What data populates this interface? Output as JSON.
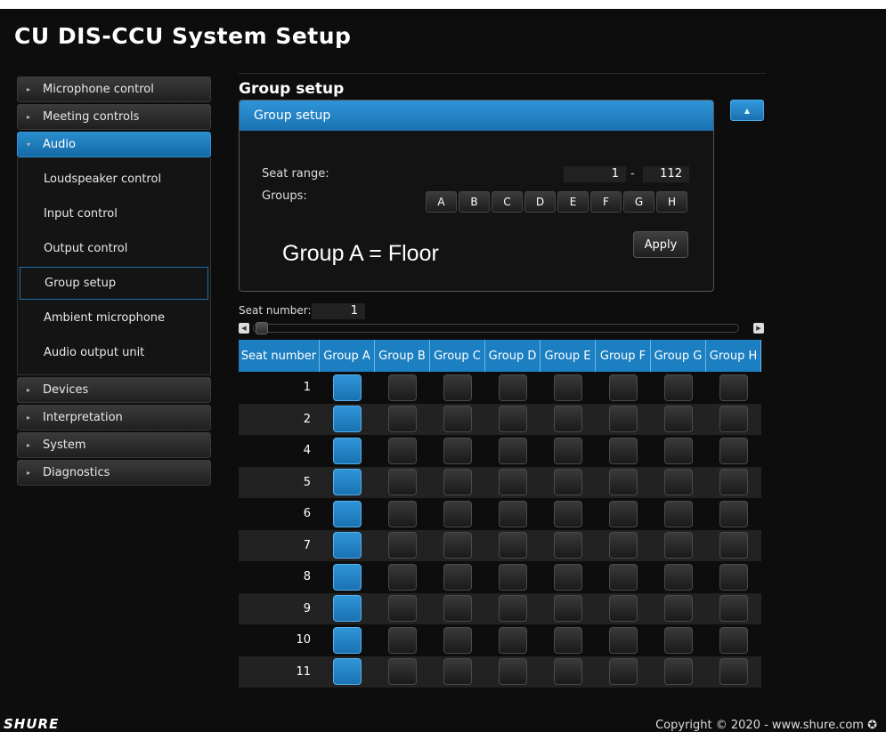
{
  "app": {
    "title": "CU DIS-CCU System Setup"
  },
  "sidebar": {
    "items": [
      {
        "label": "Microphone control"
      },
      {
        "label": "Meeting controls"
      },
      {
        "label": "Audio"
      },
      {
        "label": "Devices"
      },
      {
        "label": "Interpretation"
      },
      {
        "label": "System"
      },
      {
        "label": "Diagnostics"
      }
    ],
    "audio_subitems": [
      {
        "label": "Loudspeaker control"
      },
      {
        "label": "Input control"
      },
      {
        "label": "Output control"
      },
      {
        "label": "Group setup"
      },
      {
        "label": "Ambient microphone"
      },
      {
        "label": "Audio output unit"
      }
    ],
    "selected": "Group setup"
  },
  "main": {
    "section_title": "Group setup",
    "panel": {
      "title": "Group setup",
      "seat_range_label": "Seat range:",
      "seat_range_from": "1",
      "seat_range_sep": "-",
      "seat_range_to": "112",
      "groups_label": "Groups:",
      "group_buttons": [
        "A",
        "B",
        "C",
        "D",
        "E",
        "F",
        "G",
        "H"
      ],
      "apply_label": "Apply",
      "annotation": "Group A = Floor"
    },
    "seat_number_label": "Seat number:",
    "seat_number_value": "1",
    "table": {
      "headers": [
        "Seat number",
        "Group A",
        "Group B",
        "Group C",
        "Group D",
        "Group E",
        "Group F",
        "Group G",
        "Group H"
      ],
      "rows": [
        {
          "seat": "1",
          "groups": [
            true,
            false,
            false,
            false,
            false,
            false,
            false,
            false
          ]
        },
        {
          "seat": "2",
          "groups": [
            true,
            false,
            false,
            false,
            false,
            false,
            false,
            false
          ]
        },
        {
          "seat": "4",
          "groups": [
            true,
            false,
            false,
            false,
            false,
            false,
            false,
            false
          ]
        },
        {
          "seat": "5",
          "groups": [
            true,
            false,
            false,
            false,
            false,
            false,
            false,
            false
          ]
        },
        {
          "seat": "6",
          "groups": [
            true,
            false,
            false,
            false,
            false,
            false,
            false,
            false
          ]
        },
        {
          "seat": "7",
          "groups": [
            true,
            false,
            false,
            false,
            false,
            false,
            false,
            false
          ]
        },
        {
          "seat": "8",
          "groups": [
            true,
            false,
            false,
            false,
            false,
            false,
            false,
            false
          ]
        },
        {
          "seat": "9",
          "groups": [
            true,
            false,
            false,
            false,
            false,
            false,
            false,
            false
          ]
        },
        {
          "seat": "10",
          "groups": [
            true,
            false,
            false,
            false,
            false,
            false,
            false,
            false
          ]
        },
        {
          "seat": "11",
          "groups": [
            true,
            false,
            false,
            false,
            false,
            false,
            false,
            false
          ]
        }
      ]
    }
  },
  "footer": {
    "logo": "SHURE",
    "copyright": "Copyright © 2020 - www.shure.com ✪"
  },
  "colors": {
    "accent": "#1b7fc2",
    "background": "#0d0d0d"
  }
}
